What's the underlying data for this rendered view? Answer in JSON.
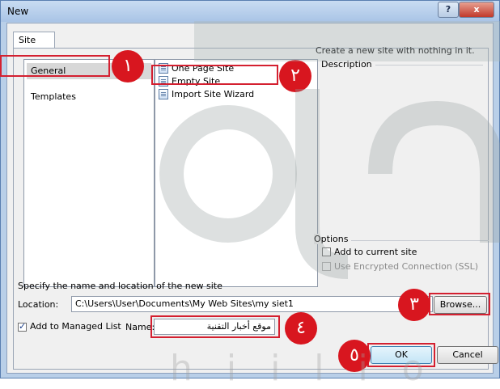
{
  "window": {
    "title": "New",
    "help_label": "?",
    "close_label": "x"
  },
  "tab": {
    "label": "Site"
  },
  "categories": [
    {
      "label": "General",
      "selected": true
    },
    {
      "label": "Templates",
      "selected": false
    }
  ],
  "templates": [
    {
      "label": "One Page Site",
      "icon": "page-icon"
    },
    {
      "label": "Empty Site",
      "icon": "page-icon"
    },
    {
      "label": "Import Site Wizard",
      "icon": "wizard-icon"
    }
  ],
  "description": {
    "heading": "Description",
    "text": "Create a new site with nothing in it."
  },
  "options": {
    "heading": "Options",
    "add_to_current": {
      "label": "Add to current site",
      "checked": false
    },
    "use_ssl": {
      "label": "Use Encrypted Connection (SSL)",
      "checked": false,
      "disabled": true
    }
  },
  "location": {
    "prompt": "Specify the name and location of the new site",
    "label": "Location:",
    "value": "C:\\Users\\User\\Documents\\My Web Sites\\my siet1",
    "browse_label": "Browse..."
  },
  "managed_list": {
    "label": "Add to Managed List",
    "checked": true
  },
  "name": {
    "label": "Name:",
    "value": "موقع أخبار التقنية"
  },
  "buttons": {
    "ok": "OK",
    "cancel": "Cancel"
  },
  "markers": [
    "١",
    "٢",
    "٣",
    "٤",
    "٥"
  ],
  "watermark": {
    "logo_text": "عين",
    "latin_text": "h i i l i o"
  },
  "colors": {
    "marker": "#d8161f",
    "highlight": "#d42030"
  }
}
